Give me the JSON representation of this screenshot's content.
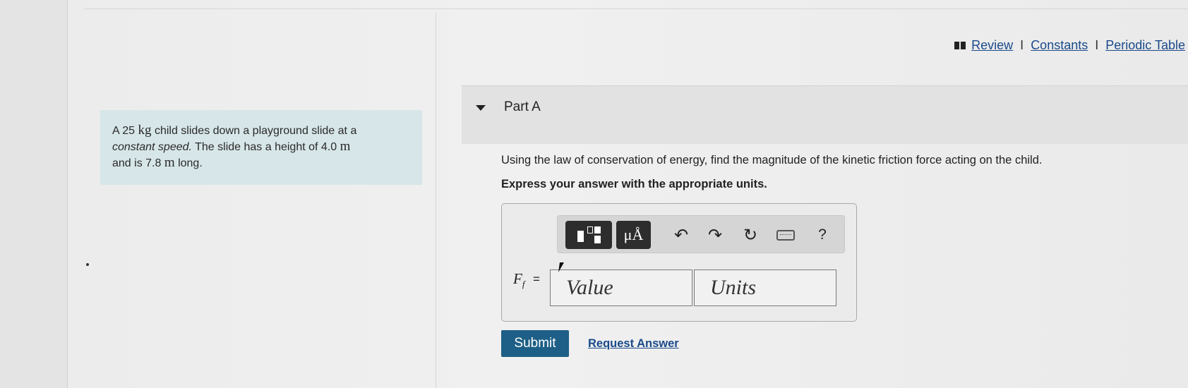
{
  "header": {
    "links": [
      {
        "label": "Review"
      },
      {
        "label": "Constants"
      },
      {
        "label": "Periodic Table"
      }
    ],
    "separator": "I"
  },
  "problem": {
    "line1_pre": "A 25",
    "mass_unit": "kg",
    "line1_post": "child slides down a playground slide at a",
    "line2_italic": "constant speed.",
    "line2_post": "The slide has a height of 4.0",
    "height_unit": "m",
    "line3_pre": "and is 7.8",
    "length_unit": "m",
    "line3_post": "long."
  },
  "part": {
    "title": "Part A",
    "question": "Using the law of conservation of energy, find the magnitude of the kinetic friction force acting on the child.",
    "instruction": "Express your answer with the appropriate units."
  },
  "answer": {
    "variable": "F",
    "variable_sub": "f",
    "equals": "=",
    "value_placeholder": "Value",
    "units_placeholder": "Units",
    "toolbar": {
      "units_label": "μÅ",
      "help_label": "?",
      "icons": [
        "templates-icon",
        "units-icon",
        "undo-icon",
        "redo-icon",
        "reset-icon",
        "keyboard-icon",
        "help-icon"
      ]
    }
  },
  "actions": {
    "submit_label": "Submit",
    "request_label": "Request Answer"
  }
}
